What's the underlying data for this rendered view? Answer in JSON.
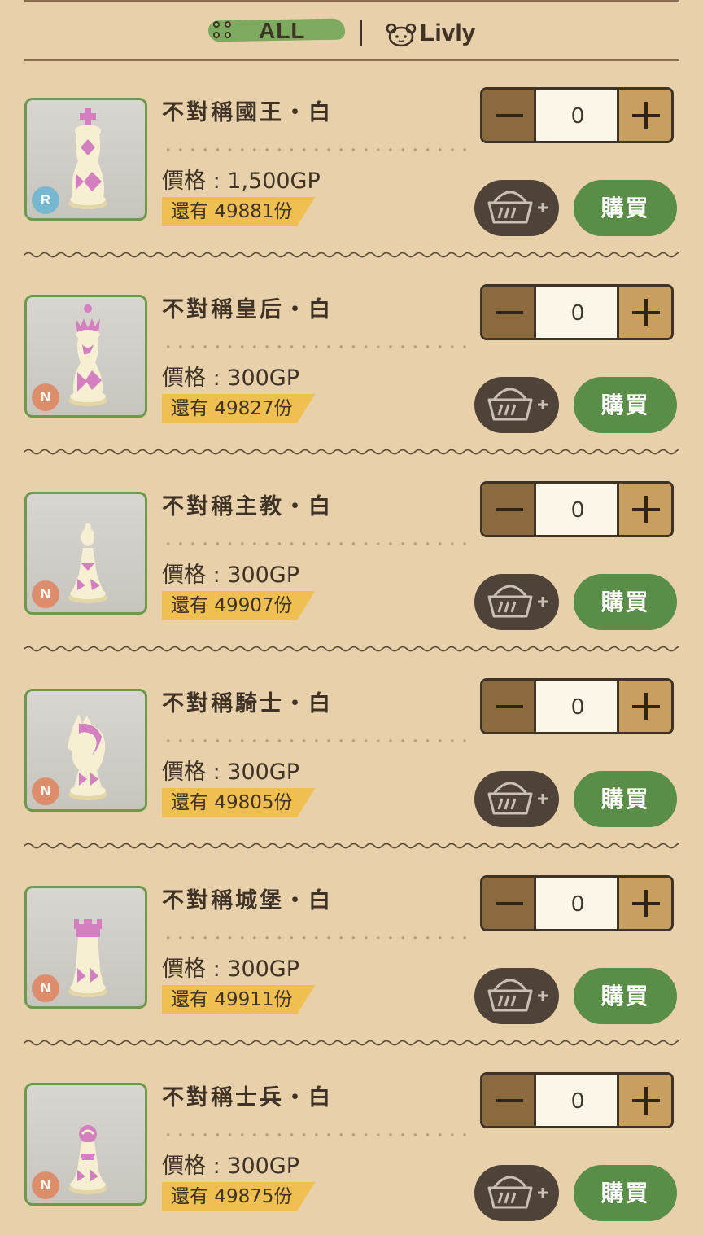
{
  "filter": {
    "all_label": "ALL",
    "livly_label": "Livly"
  },
  "items": [
    {
      "name": "不對稱國王・白",
      "price": "價格 : 1,500GP",
      "stock": "還有 49881份",
      "rarity": "R",
      "quantity": "0",
      "buy_label": "購買",
      "piece": "king"
    },
    {
      "name": "不對稱皇后・白",
      "price": "價格 : 300GP",
      "stock": "還有 49827份",
      "rarity": "N",
      "quantity": "0",
      "buy_label": "購買",
      "piece": "queen"
    },
    {
      "name": "不對稱主教・白",
      "price": "價格 : 300GP",
      "stock": "還有 49907份",
      "rarity": "N",
      "quantity": "0",
      "buy_label": "購買",
      "piece": "bishop"
    },
    {
      "name": "不對稱騎士・白",
      "price": "價格 : 300GP",
      "stock": "還有 49805份",
      "rarity": "N",
      "quantity": "0",
      "buy_label": "購買",
      "piece": "knight"
    },
    {
      "name": "不對稱城堡・白",
      "price": "價格 : 300GP",
      "stock": "還有 49911份",
      "rarity": "N",
      "quantity": "0",
      "buy_label": "購買",
      "piece": "rook"
    },
    {
      "name": "不對稱士兵・白",
      "price": "價格 : 300GP",
      "stock": "還有 49875份",
      "rarity": "N",
      "quantity": "0",
      "buy_label": "購買",
      "piece": "pawn"
    }
  ],
  "colors": {
    "background": "#e8d1aa",
    "accent_green": "#5a8d47",
    "stock_tag": "#f0bf52",
    "rarity_r": "#77b8d0",
    "rarity_n": "#dc8e6c"
  },
  "icons": {
    "filter_all": "grid-dots-icon",
    "filter_livly": "livly-face-icon",
    "cart": "basket-plus-icon"
  }
}
